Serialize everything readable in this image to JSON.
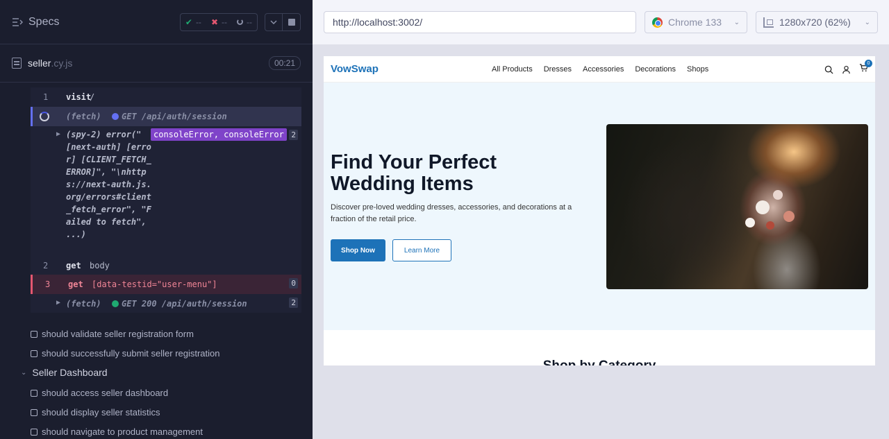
{
  "runner": {
    "specs_title": "Specs",
    "stats": {
      "passed": "--",
      "failed": "--",
      "pending": "--"
    },
    "spec_file": {
      "name": "seller",
      "ext": ".cy.js",
      "duration": "00:21"
    },
    "commands": [
      {
        "num": "1",
        "name": "visit",
        "message": "/"
      },
      {
        "kind": "(fetch)",
        "message": "GET /api/auth/session"
      },
      {
        "kind": "(spy-2)",
        "message": "error(\" [next-auth] [error] [CLIENT_FETCH_ERROR]\", \"\\nhttps://next-auth.js.org/errors#client_fetch_error\", \"Failed to fetch\", ...)",
        "alias": "consoleError, consoleError",
        "count": "2"
      },
      {
        "num": "2",
        "name": "get",
        "message": "body"
      },
      {
        "num": "3",
        "name": "get",
        "message": "[data-testid=\"user-menu\"]",
        "count": "0"
      },
      {
        "kind": "(fetch)",
        "message": "GET 200 /api/auth/session",
        "count": "2"
      }
    ],
    "tests_before": [
      "should validate seller registration form",
      "should successfully submit seller registration"
    ],
    "suite": "Seller Dashboard",
    "tests_after": [
      "should access seller dashboard",
      "should display seller statistics",
      "should navigate to product management"
    ]
  },
  "browser": {
    "url": "http://localhost:3002/",
    "browser_name": "Chrome 133",
    "viewport": "1280x720",
    "scale": "(62%)"
  },
  "app": {
    "brand": "VowSwap",
    "nav": [
      "All Products",
      "Dresses",
      "Accessories",
      "Decorations",
      "Shops"
    ],
    "cart_count": "0",
    "hero_title": "Find Your Perfect Wedding Items",
    "hero_subtitle": "Discover pre-loved wedding dresses, accessories, and decorations at a fraction of the retail price.",
    "primary_cta": "Shop Now",
    "secondary_cta": "Learn More",
    "section_title": "Shop by Category"
  },
  "colors": {
    "runner_bg": "#1b1e2e",
    "brand": "#1d72b8",
    "fail": "#e45770",
    "pass": "#1fa971",
    "alias_badge": "#7f43c9"
  }
}
